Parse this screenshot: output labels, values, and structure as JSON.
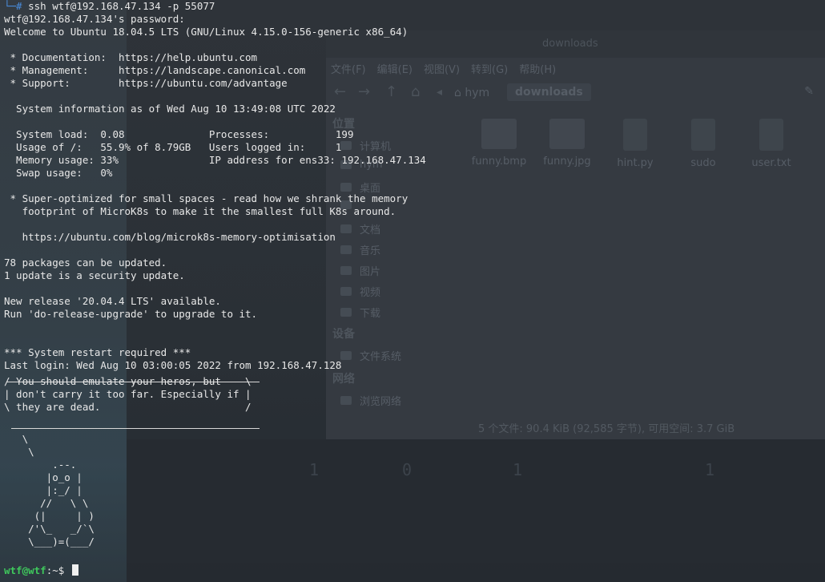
{
  "file_manager": {
    "title": "downloads",
    "menu": [
      "文件(F)",
      "编辑(E)",
      "视图(V)",
      "转到(G)",
      "帮助(H)"
    ],
    "path": {
      "home": "hym",
      "current": "downloads"
    },
    "sidebar": {
      "section_places": "位置",
      "places": [
        "计算机",
        "hym",
        "桌面",
        "",
        "文档",
        "音乐",
        "图片",
        "视频",
        "下载"
      ],
      "section_devices": "设备",
      "devices": [
        "文件系统"
      ],
      "section_network": "网络",
      "network": [
        "浏览网络"
      ]
    },
    "files": [
      "funny.bmp",
      "funny.jpg",
      "hint.py",
      "sudo",
      "user.txt"
    ],
    "status": "5 个文件: 90.4 KiB (92,585 字节), 可用空间: 3.7 GiB"
  },
  "terminal": {
    "command_prompt": "└─#",
    "command": "ssh wtf@192.168.47.134 -p 55077",
    "lines": [
      "wtf@192.168.47.134's password:",
      "Welcome to Ubuntu 18.04.5 LTS (GNU/Linux 4.15.0-156-generic x86_64)",
      "",
      " * Documentation:  https://help.ubuntu.com",
      " * Management:     https://landscape.canonical.com",
      " * Support:        https://ubuntu.com/advantage",
      "",
      "  System information as of Wed Aug 10 13:49:08 UTC 2022",
      "",
      "  System load:  0.08              Processes:           199",
      "  Usage of /:   55.9% of 8.79GB   Users logged in:     1",
      "  Memory usage: 33%               IP address for ens33: 192.168.47.134",
      "  Swap usage:   0%",
      "",
      " * Super-optimized for small spaces - read how we shrank the memory",
      "   footprint of MicroK8s to make it the smallest full K8s around.",
      "",
      "   https://ubuntu.com/blog/microk8s-memory-optimisation",
      "",
      "78 packages can be updated.",
      "1 update is a security update.",
      "",
      "New release '20.04.4 LTS' available.",
      "Run 'do-release-upgrade' to upgrade to it.",
      "",
      "",
      "*** System restart required ***",
      "Last login: Wed Aug 10 03:00:05 2022 from 192.168.47.128"
    ],
    "cowsay": [
      "/ You should emulate your heros, but    \\",
      "| don't carry it too far. Especially if |",
      "\\ they are dead.                        /"
    ],
    "tux": [
      "",
      "   \\",
      "    \\",
      "        .--.",
      "       |o_o |",
      "       |:_/ |",
      "      //   \\ \\",
      "     (|     | )",
      "    /'\\_   _/`\\",
      "    \\___)=(___/"
    ],
    "prompt_user": "wtf@wtf",
    "prompt_path": ":~$"
  }
}
